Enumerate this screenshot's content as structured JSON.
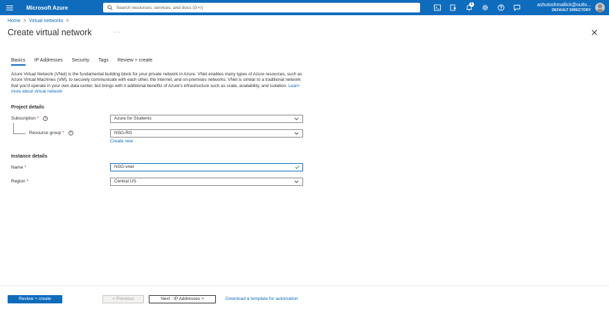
{
  "topbar": {
    "brand": "Microsoft Azure",
    "search_placeholder": "Search resources, services, and docs (G+/)",
    "notification_count": "1",
    "account_email": "ashutoshmallick@outlo...",
    "account_directory": "DEFAULT DIRECTORY",
    "icons": [
      "terminal-icon",
      "directory-filter-icon",
      "bell-icon",
      "gear-icon",
      "help-icon",
      "feedback-icon"
    ],
    "accent_color": "#0f6cbd"
  },
  "breadcrumb": {
    "home": "Home",
    "sep1": ">",
    "virtual_networks": "Virtual networks",
    "sep2": ">"
  },
  "page": {
    "title": "Create virtual network",
    "more": "···"
  },
  "tabs": [
    "Basics",
    "IP Addresses",
    "Security",
    "Tags",
    "Review + create"
  ],
  "description": {
    "text": "Azure Virtual Network (VNet) is the fundamental building block for your private network in Azure. VNet enables many types of Azure resources, such as Azure Virtual Machines (VM), to securely communicate with each other, the internet, and on-premises networks. VNet is similar to a traditional network that you'd operate in your own data center, but brings with it additional benefits of Azure's infrastructure such as scale, availability, and isolation.",
    "link": "Learn more about virtual network"
  },
  "project_details": {
    "heading": "Project details",
    "subscription_label": "Subscription",
    "subscription_value": "Azure for Students",
    "resource_group_label": "Resource group",
    "resource_group_value": "NSG-RG",
    "create_new": "Create new"
  },
  "instance_details": {
    "heading": "Instance details",
    "name_label": "Name",
    "name_value": "NSG-vnet",
    "region_label": "Region",
    "region_value": "Central US"
  },
  "required_mark": "*",
  "info_mark": "i",
  "footer": {
    "review_create": "Review + create",
    "previous": "< Previous",
    "next": "Next : IP Addresses >",
    "template_link": "Download a template for automation"
  }
}
